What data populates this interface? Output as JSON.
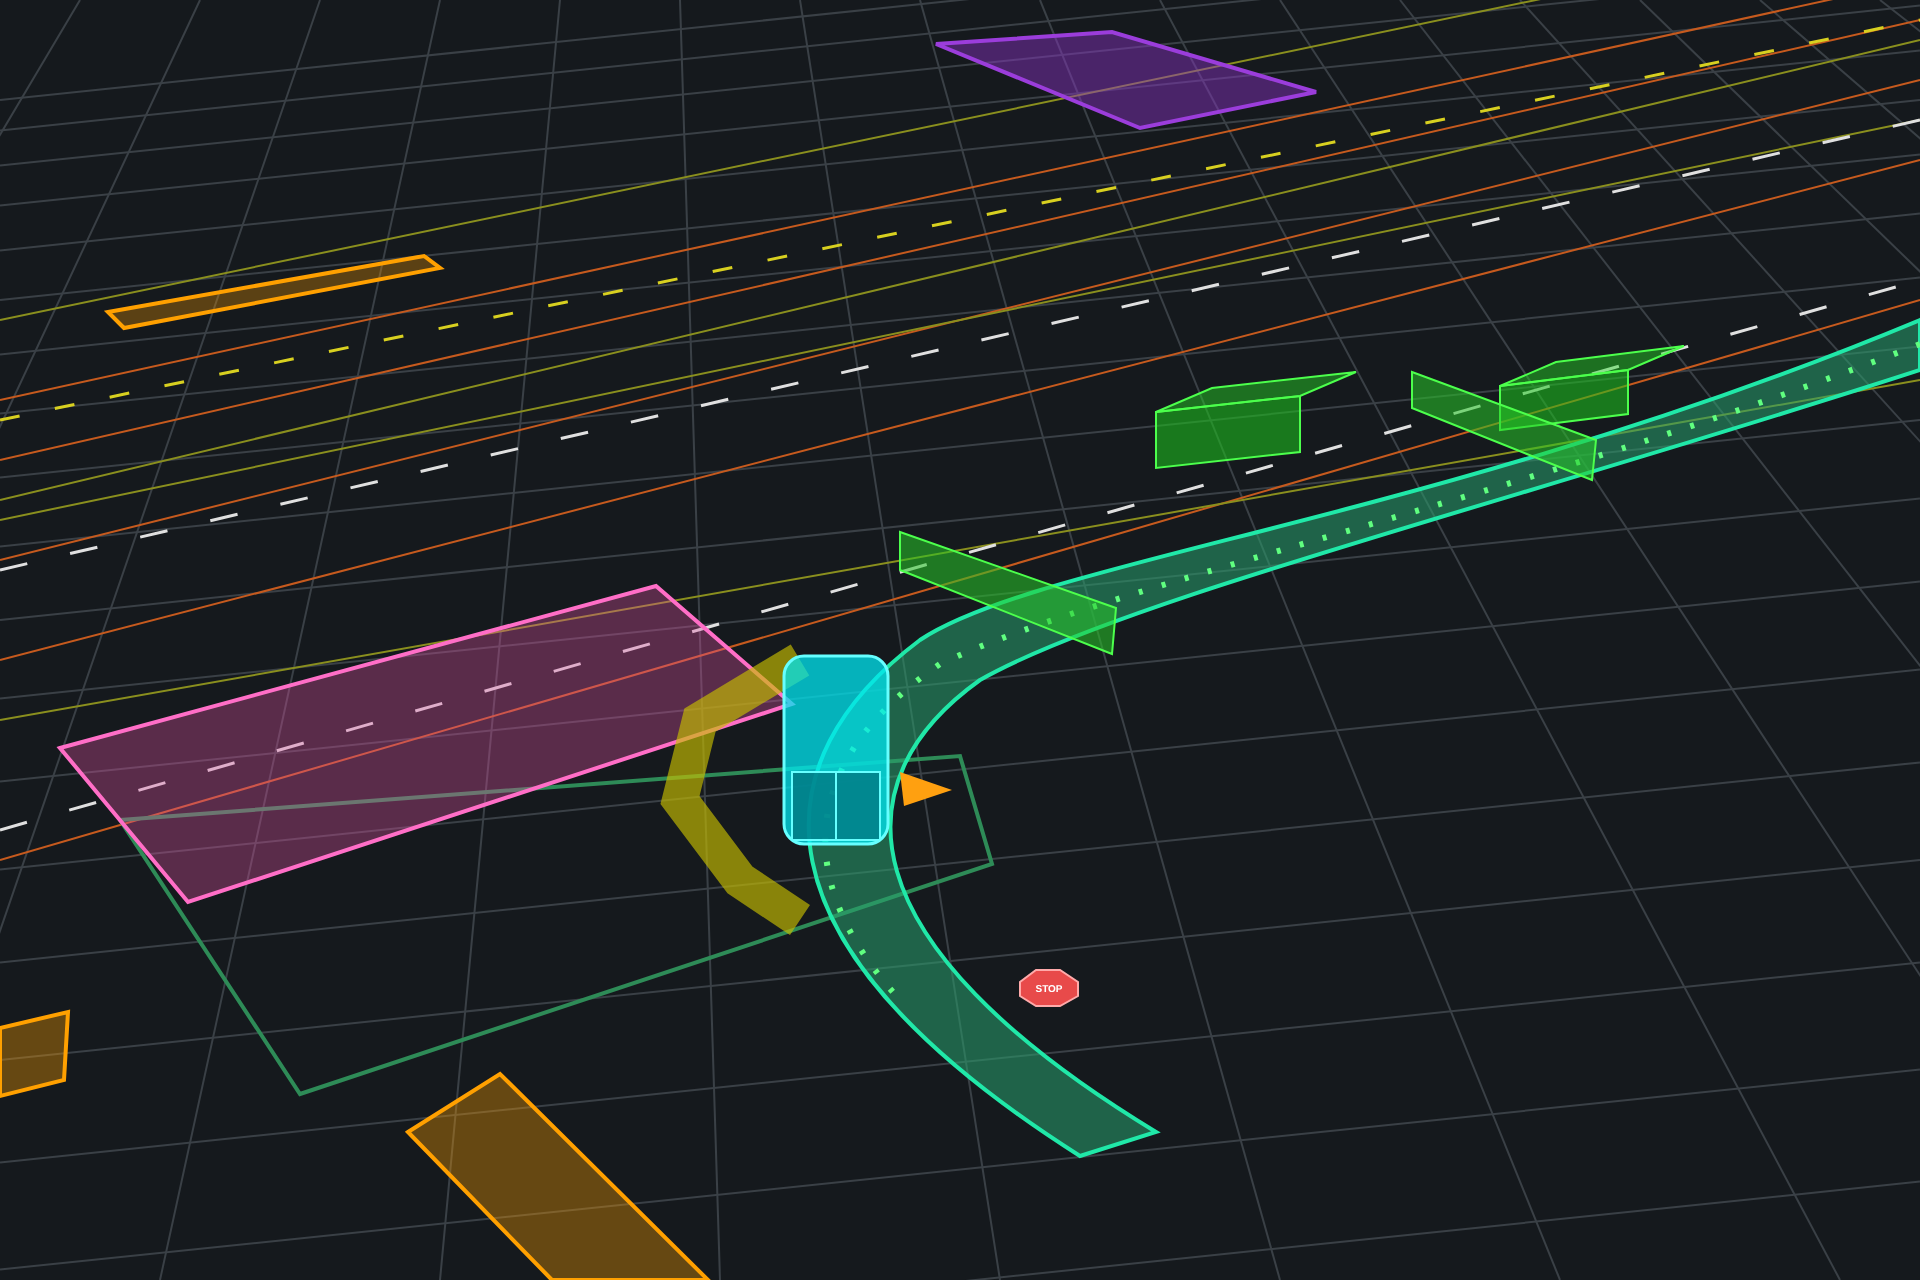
{
  "scene": {
    "stop_sign": {
      "label": "STOP"
    }
  }
}
